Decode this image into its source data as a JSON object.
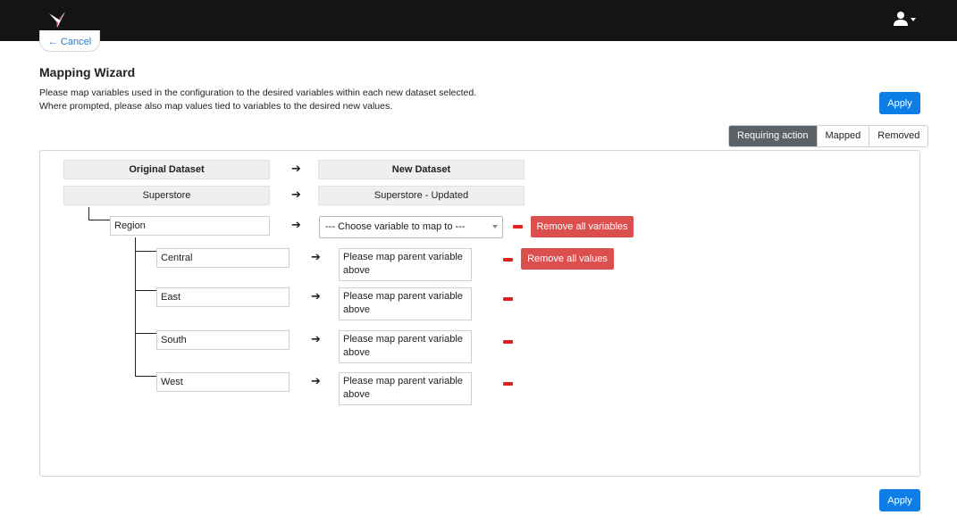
{
  "header": {
    "logo_icon": "hummingbird-logo",
    "user_icon": "user-icon",
    "cancel_label": "← Cancel"
  },
  "page": {
    "title": "Mapping Wizard",
    "description_line1": "Please map variables used in the configuration to the desired variables within each new dataset selected.",
    "description_line2": "Where prompted, please also map values tied to variables to the desired new values.",
    "apply_label": "Apply"
  },
  "tabs": [
    {
      "label": "Requiring action",
      "active": true
    },
    {
      "label": "Mapped",
      "active": false
    },
    {
      "label": "Removed",
      "active": false
    }
  ],
  "mapping": {
    "original_header": "Original Dataset",
    "new_header": "New Dataset",
    "original_dataset": "Superstore",
    "new_dataset": "Superstore - Updated",
    "variable": {
      "name": "Region",
      "select_placeholder": "--- Choose variable to map to ---",
      "remove_all_variables_label": "Remove all variables",
      "remove_all_values_label": "Remove all values"
    },
    "values": [
      {
        "original": "Central",
        "target": "Please map parent variable above"
      },
      {
        "original": "East",
        "target": "Please map parent variable above"
      },
      {
        "original": "South",
        "target": "Please map parent variable above"
      },
      {
        "original": "West",
        "target": "Please map parent variable above"
      }
    ]
  },
  "colors": {
    "topbar": "#141414",
    "primary": "#0d7ee8",
    "danger": "#dc4f4f",
    "minus": "#e02020",
    "active_tab": "#5a6268"
  }
}
